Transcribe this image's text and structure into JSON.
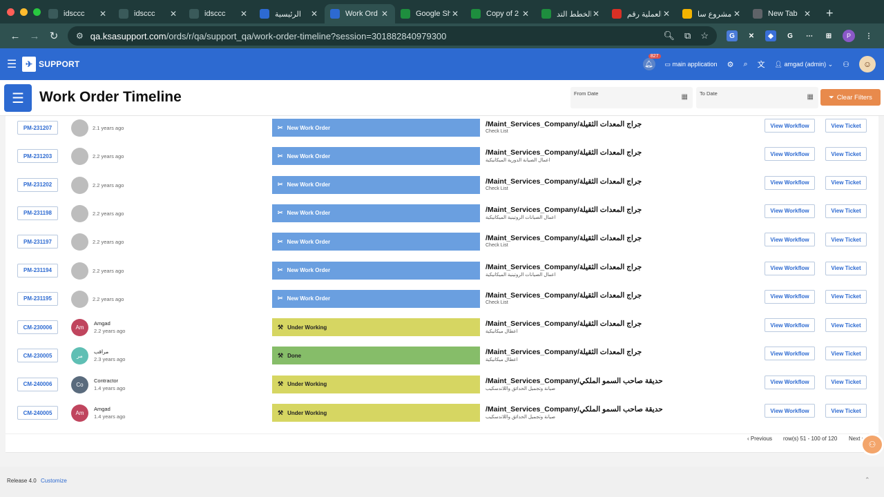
{
  "browser": {
    "tabs": [
      {
        "title": "idsccc",
        "icon": "doc-icon",
        "color": "#3a5a5a",
        "active": false
      },
      {
        "title": "idsccc",
        "icon": "doc-icon",
        "color": "#3a5a5a",
        "active": false
      },
      {
        "title": "idsccc",
        "icon": "doc-icon",
        "color": "#3a5a5a",
        "active": false
      },
      {
        "title": "الرئيسية",
        "icon": "site-icon",
        "color": "#2d6ad1",
        "active": false
      },
      {
        "title": "Work Ord",
        "icon": "site-icon",
        "color": "#2d6ad1",
        "active": true
      },
      {
        "title": "Google Sh",
        "icon": "sheets-icon",
        "color": "#1e8e3e",
        "active": false
      },
      {
        "title": "Copy of 2",
        "icon": "sheets-icon",
        "color": "#1e8e3e",
        "active": false
      },
      {
        "title": "الخطط التد",
        "icon": "sheets-icon",
        "color": "#1e8e3e",
        "active": false
      },
      {
        "title": "العملية رقم",
        "icon": "gmail-icon",
        "color": "#d93025",
        "active": false
      },
      {
        "title": "مشروع سا",
        "icon": "drive-icon",
        "color": "#f4b400",
        "active": false
      },
      {
        "title": "New Tab",
        "icon": "chrome-icon",
        "color": "#5f6368",
        "active": false
      }
    ],
    "url_host": "qa.ksasupport.com",
    "url_path": "/ords/r/qa/support_qa/work-order-timeline?session=301882840979300"
  },
  "app": {
    "name": "SUPPORT",
    "notification_count": "827",
    "main_app_label": "main application",
    "user_label": "amgad (admin)"
  },
  "page": {
    "title": "Work Order Timeline",
    "from_date_label": "From Date",
    "to_date_label": "To Date",
    "clear_filters_label": "Clear Filters"
  },
  "colors": {
    "new": "#6a9fe0",
    "working": "#d6d662",
    "done": "#86bd69"
  },
  "rows": [
    {
      "id": "PM-231207",
      "user": "",
      "initials": "",
      "avatar": "#bdbdbd",
      "time": "2.1 years ago",
      "status": "New Work Order",
      "kind": "new",
      "title": "/Maint_Services_Company/جراج المعدات الثقيلة",
      "sub": "Check List"
    },
    {
      "id": "PM-231203",
      "user": "",
      "initials": "",
      "avatar": "#bdbdbd",
      "time": "2.2 years ago",
      "status": "New Work Order",
      "kind": "new",
      "title": "/Maint_Services_Company/جراج المعدات الثقيلة",
      "sub": "اعمال الصيانة الدورية الميكانيكية"
    },
    {
      "id": "PM-231202",
      "user": "",
      "initials": "",
      "avatar": "#bdbdbd",
      "time": "2.2 years ago",
      "status": "New Work Order",
      "kind": "new",
      "title": "/Maint_Services_Company/جراج المعدات الثقيلة",
      "sub": "Check List"
    },
    {
      "id": "PM-231198",
      "user": "",
      "initials": "",
      "avatar": "#bdbdbd",
      "time": "2.2 years ago",
      "status": "New Work Order",
      "kind": "new",
      "title": "/Maint_Services_Company/جراج المعدات الثقيلة",
      "sub": "اعمال الصيانات الروتينية الميكانيكية"
    },
    {
      "id": "PM-231197",
      "user": "",
      "initials": "",
      "avatar": "#bdbdbd",
      "time": "2.2 years ago",
      "status": "New Work Order",
      "kind": "new",
      "title": "/Maint_Services_Company/جراج المعدات الثقيلة",
      "sub": "Check List"
    },
    {
      "id": "PM-231194",
      "user": "",
      "initials": "",
      "avatar": "#bdbdbd",
      "time": "2.2 years ago",
      "status": "New Work Order",
      "kind": "new",
      "title": "/Maint_Services_Company/جراج المعدات الثقيلة",
      "sub": "اعمال الصيانات الروتينية الميكانيكية"
    },
    {
      "id": "PM-231195",
      "user": "",
      "initials": "",
      "avatar": "#bdbdbd",
      "time": "2.2 years ago",
      "status": "New Work Order",
      "kind": "new",
      "title": "/Maint_Services_Company/جراج المعدات الثقيلة",
      "sub": "Check List"
    },
    {
      "id": "CM-230006",
      "user": "Amgad",
      "initials": "Am",
      "avatar": "#c0455e",
      "time": "2.2 years ago",
      "status": "Under Working",
      "kind": "working",
      "title": "/Maint_Services_Company/جراج المعدات الثقيلة",
      "sub": "اعطال ميكانيكية"
    },
    {
      "id": "CM-230005",
      "user": "مراقب",
      "initials": "مر",
      "avatar": "#5fbfb4",
      "time": "2.3 years ago",
      "status": "Done",
      "kind": "done",
      "title": "/Maint_Services_Company/جراج المعدات الثقيلة",
      "sub": "اعطال ميكانيكية"
    },
    {
      "id": "CM-240006",
      "user": "Contractor",
      "initials": "Co",
      "avatar": "#5a6b7d",
      "time": "1.4 years ago",
      "status": "Under Working",
      "kind": "working",
      "title": "/Maint_Services_Company/حديقة صاحب السمو الملكي",
      "sub": "صيانة وتجميل الحدائق واللاندسكيب"
    },
    {
      "id": "CM-240005",
      "user": "Amgad",
      "initials": "Am",
      "avatar": "#c0455e",
      "time": "1.4 years ago",
      "status": "Under Working",
      "kind": "working",
      "title": "/Maint_Services_Company/حديقة صاحب السمو الملكي",
      "sub": "صيانة وتجميل الحدائق واللاندسكيب"
    }
  ],
  "row_buttons": {
    "view_workflow": "View Workflow",
    "view_ticket": "View Ticket"
  },
  "pagination": {
    "prev": "‹ Previous",
    "range": "row(s) 51 - 100 of 120",
    "next": "Next ›"
  },
  "footer": {
    "release": "Release 4.0",
    "customize": "Customize"
  }
}
